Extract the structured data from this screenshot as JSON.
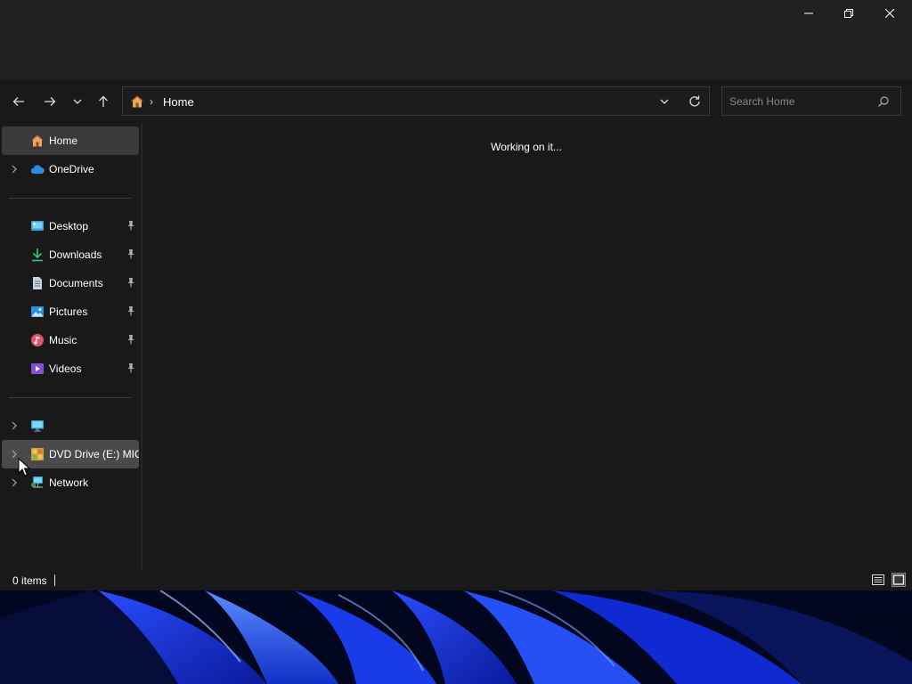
{
  "window": {
    "caption_buttons": [
      "minimize-icon",
      "restore-icon",
      "close-icon"
    ]
  },
  "navigation": {
    "back_icon": "arrow-left-icon",
    "forward_icon": "arrow-right-icon",
    "recent_icon": "chevron-down-icon",
    "up_icon": "arrow-up-icon"
  },
  "address_bar": {
    "location_icon": "home-icon",
    "separator": "›",
    "crumb": "Home",
    "dropdown_icon": "chevron-down-icon",
    "refresh_icon": "refresh-icon"
  },
  "search": {
    "placeholder": "Search Home",
    "value": "",
    "icon": "search-icon"
  },
  "sidebar": {
    "top_items": [
      {
        "label": "Home",
        "icon": "home-icon",
        "selected": true,
        "expandable": false
      },
      {
        "label": "OneDrive",
        "icon": "cloud-icon",
        "selected": false,
        "expandable": true
      }
    ],
    "quick_access": [
      {
        "label": "Desktop",
        "icon": "desktop-folder-icon",
        "pinned": true
      },
      {
        "label": "Downloads",
        "icon": "download-icon",
        "pinned": true
      },
      {
        "label": "Documents",
        "icon": "document-icon",
        "pinned": true
      },
      {
        "label": "Pictures",
        "icon": "picture-icon",
        "pinned": true
      },
      {
        "label": "Music",
        "icon": "music-icon",
        "pinned": true
      },
      {
        "label": "Videos",
        "icon": "video-icon",
        "pinned": true
      }
    ],
    "devices": [
      {
        "label": "",
        "icon": "computer-icon",
        "expandable": true
      },
      {
        "label": "DVD Drive (E:) MICR",
        "icon": "dvd-drive-icon",
        "expandable": true,
        "hovered": true
      },
      {
        "label": "Network",
        "icon": "network-icon",
        "expandable": true
      }
    ]
  },
  "content": {
    "message": "Working on it..."
  },
  "status_bar": {
    "item_count": "0 items",
    "view_buttons": [
      "details-view-icon",
      "large-icons-view-icon"
    ]
  },
  "colors": {
    "window_bg": "#191919",
    "titlebar_bg": "#202020",
    "selected_bg": "#3a3a3a",
    "accent_blue": "#1e6fe0"
  }
}
